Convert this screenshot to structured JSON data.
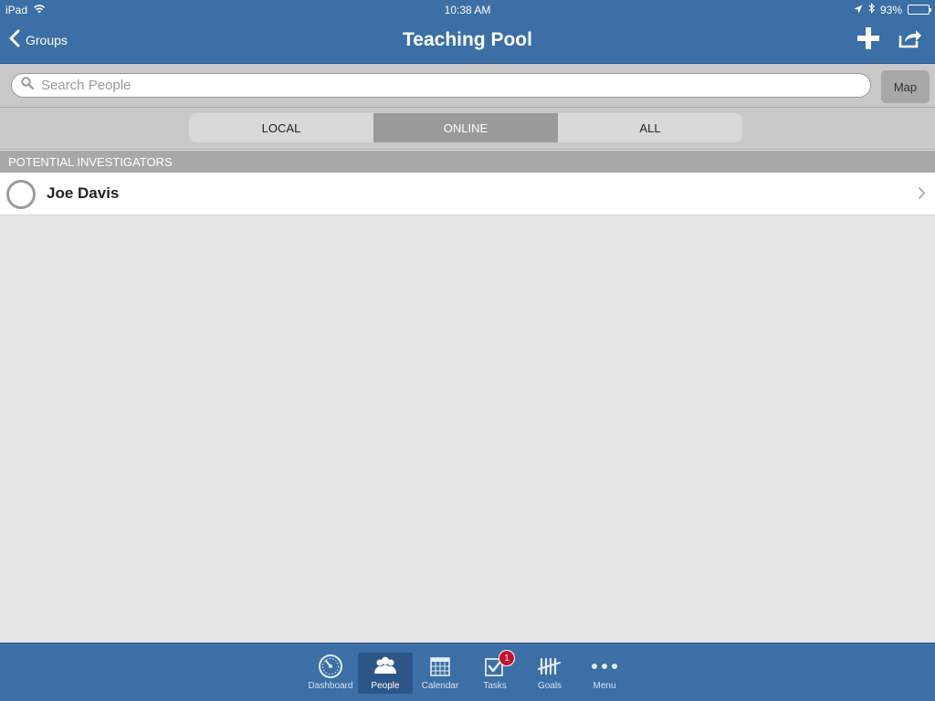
{
  "status_bar": {
    "device": "iPad",
    "time": "10:38 AM",
    "battery": "93%",
    "battery_level": 0.93
  },
  "nav": {
    "back_label": "Groups",
    "title": "Teaching Pool",
    "add_icon": "plus-icon",
    "share_icon": "share-icon"
  },
  "search": {
    "placeholder": "Search People",
    "value": "",
    "map_label": "Map"
  },
  "segments": {
    "items": [
      "LOCAL",
      "ONLINE",
      "ALL"
    ],
    "selected": "ONLINE"
  },
  "list": {
    "section_title": "POTENTIAL INVESTIGATORS",
    "rows": [
      {
        "name": "Joe Davis"
      }
    ]
  },
  "tab_bar": {
    "items": [
      {
        "label": "Dashboard",
        "icon": "dashboard-icon"
      },
      {
        "label": "People",
        "icon": "people-icon"
      },
      {
        "label": "Calendar",
        "icon": "calendar-icon"
      },
      {
        "label": "Tasks",
        "icon": "tasks-icon",
        "badge": "1"
      },
      {
        "label": "Goals",
        "icon": "goals-icon"
      },
      {
        "label": "Menu",
        "icon": "menu-icon"
      }
    ],
    "selected": "People"
  },
  "colors": {
    "primary": "#3b6fa6",
    "badge": "#c8102e"
  }
}
